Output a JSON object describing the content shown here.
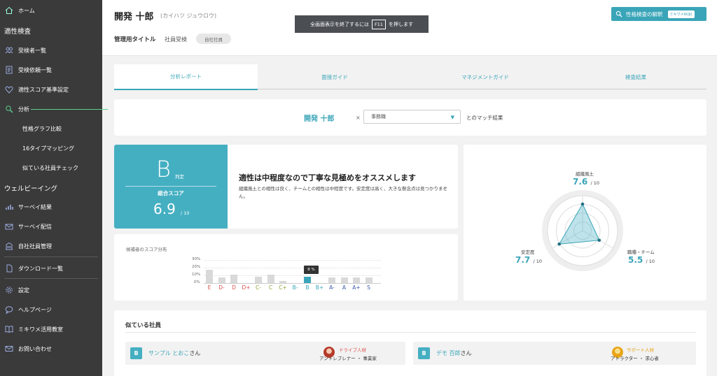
{
  "sidebar": {
    "home": "ホーム",
    "section_aptitude": "適性検査",
    "items_a": [
      {
        "label": "受検者一覧",
        "icon": "users-icon"
      },
      {
        "label": "受検依頼一覧",
        "icon": "document-icon"
      },
      {
        "label": "適性スコア基準設定",
        "icon": "heart-check-icon"
      },
      {
        "label": "分析",
        "icon": "search-icon"
      }
    ],
    "sub_items": [
      "性格グラフ比較",
      "16タイプマッピング",
      "似ている社員チェック"
    ],
    "section_wellbeing": "ウェルビーイング",
    "items_b": [
      {
        "label": "サーベイ結果",
        "icon": "chart-icon"
      },
      {
        "label": "サーベイ配信",
        "icon": "mail-icon"
      },
      {
        "label": "自社社員管理",
        "icon": "building-icon"
      }
    ],
    "download": "ダウンロード一覧",
    "items_c": [
      {
        "label": "設定",
        "icon": "gear-icon"
      },
      {
        "label": "ヘルプページ",
        "icon": "chat-icon"
      },
      {
        "label": "ミキワメ活用教室",
        "icon": "book-icon"
      },
      {
        "label": "お問い合わせ",
        "icon": "envelope-icon"
      }
    ]
  },
  "header": {
    "name": "開発 十郎",
    "kana": "(カイハツ ジュウロウ)",
    "mgmt_label": "管理用タイトル",
    "mgmt_value": "社員受検",
    "mgmt_pill": "自社社員",
    "toast_before": "全画面表示を終了するには",
    "toast_key": "F11",
    "toast_after": "を押します",
    "button_label": "性格検査の解釈",
    "button_tag": "ミキワメAI(β)"
  },
  "tabs": [
    "分析レポート",
    "面接ガイド",
    "マネジメントガイド",
    "検査結果"
  ],
  "match": {
    "name": "開発 十郎",
    "times": "×",
    "selected_job": "事務職",
    "result_label": "とのマッチ結果"
  },
  "score": {
    "grade": "B",
    "grade_suffix": "判定",
    "total_label": "総合スコア",
    "total_value": "6.9",
    "total_denominator": "/ 10",
    "headline": "適性は中程度なので丁寧な見極めをオススメします",
    "description": "組織風土との相性は良く、チームとの相性は中程度です。安定度は高く、大きな懸念点は見つかりません。"
  },
  "distribution": {
    "title": "候補者のスコア分布",
    "y_ticks": [
      "30%",
      "20%",
      "10%",
      "0%"
    ],
    "tooltip": "8 %"
  },
  "chart_data": {
    "type": "bar",
    "title": "候補者のスコア分布",
    "categories": [
      "E",
      "D-",
      "D",
      "D+",
      "C-",
      "C",
      "C+",
      "B-",
      "B",
      "B+",
      "A-",
      "A",
      "A+",
      "S"
    ],
    "values": [
      17,
      7,
      11,
      0,
      8,
      11,
      3,
      0,
      8,
      0,
      7,
      7,
      7,
      7
    ],
    "ylim": [
      0,
      30
    ],
    "highlight": "B",
    "grid": true
  },
  "radar": {
    "axes": [
      {
        "label": "組織風土",
        "value": "7.6",
        "den": "/ 10"
      },
      {
        "label": "職種・チーム",
        "value": "5.5",
        "den": "/ 10"
      },
      {
        "label": "安定度",
        "value": "7.7",
        "den": "/ 10"
      }
    ]
  },
  "similar": {
    "title": "似ている社員",
    "people": [
      {
        "grade": "B",
        "name": "サンプル とおこ",
        "suffix": "さん",
        "type": "ドライブ人材",
        "roles": "アントレプレナー ・ 事業家",
        "type_color": "#d9534f"
      },
      {
        "grade": "B",
        "name": "デモ 百郎",
        "suffix": "さん",
        "type": "サポート人材",
        "roles": "アトラクター ・ 求心者",
        "type_color": "#e8a317"
      }
    ]
  },
  "colors": {
    "accent": "#3aa5b8",
    "sidebar": "#3a3a3a",
    "active_line": "#5ad08b"
  }
}
